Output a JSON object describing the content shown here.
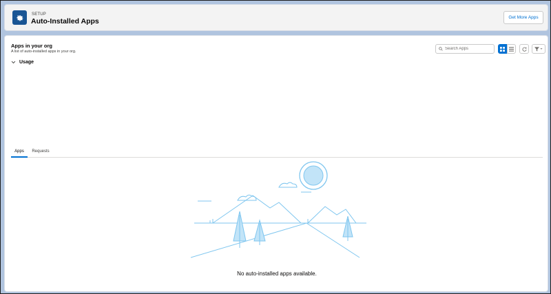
{
  "header": {
    "eyebrow": "SETUP",
    "title": "Auto-Installed Apps",
    "get_more_label": "Get More Apps",
    "icon": "gear-icon"
  },
  "section": {
    "title": "Apps in your org",
    "subtitle": "A list of auto-installed apps in your org."
  },
  "toolbar": {
    "search_placeholder": "Search Apps",
    "view_mode": "grid",
    "icons": [
      "search-icon",
      "grid-view-icon",
      "list-view-icon",
      "refresh-icon",
      "filter-icon"
    ]
  },
  "usage": {
    "label": "Usage",
    "expanded": true
  },
  "tabs": [
    {
      "label": "Apps",
      "active": true
    },
    {
      "label": "Requests",
      "active": false
    }
  ],
  "empty_state": {
    "message": "No auto-installed apps available."
  },
  "colors": {
    "brand": "#0070d2",
    "icon_bg": "#195594",
    "illustration": "#7fc6ef"
  }
}
